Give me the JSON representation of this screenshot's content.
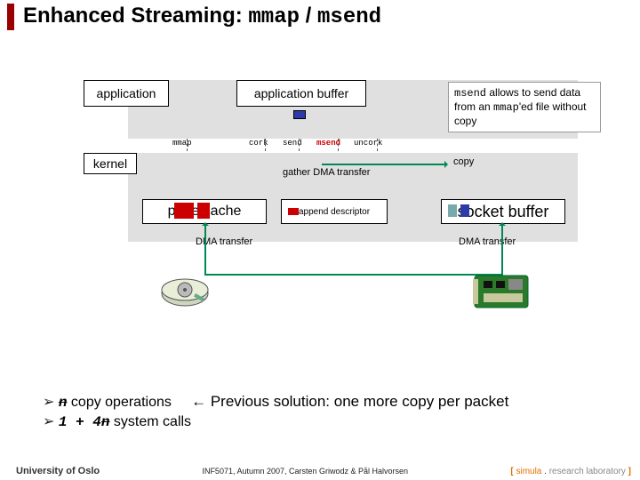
{
  "title": {
    "prefix": "Enhanced Streaming: ",
    "m1": "mmap",
    "sep": " / ",
    "m2": "msend"
  },
  "boxes": {
    "application": "application",
    "app_buffer": "application buffer",
    "kernel": "kernel",
    "page_cache": "page cache",
    "descriptor": "append descriptor",
    "socket_buffer": "socket buffer"
  },
  "arrows": {
    "mmap": "mmap",
    "cork": "cork",
    "send": "send",
    "msend": "msend",
    "uncork": "uncork",
    "gather": "gather DMA transfer",
    "copy": "copy",
    "dma_left": "DMA transfer",
    "dma_right": "DMA transfer"
  },
  "note": {
    "p1a": "msend",
    "p1b": " allows to send data from an ",
    "p2a": "mmap",
    "p2b": "'ed file without copy"
  },
  "bullets": {
    "b1_strike": "n",
    "b1_rest": " copy operations",
    "prev": "← Previous solution: one more copy per packet",
    "b2_a": "1 + 4",
    "b2_strike": "n",
    "b2_rest": " system calls"
  },
  "footer": {
    "uio": "University of Oslo",
    "course": "INF5071, Autumn 2007, Carsten Griwodz & Pål Halvorsen",
    "simula_open": "[ ",
    "simula_name": "simula",
    "simula_dot": " . ",
    "simula_lab": "research laboratory",
    "simula_close": " ]"
  },
  "colors": {
    "accent_red": "#c00",
    "accent_green": "#085",
    "band_grey": "#e0e0e0"
  }
}
